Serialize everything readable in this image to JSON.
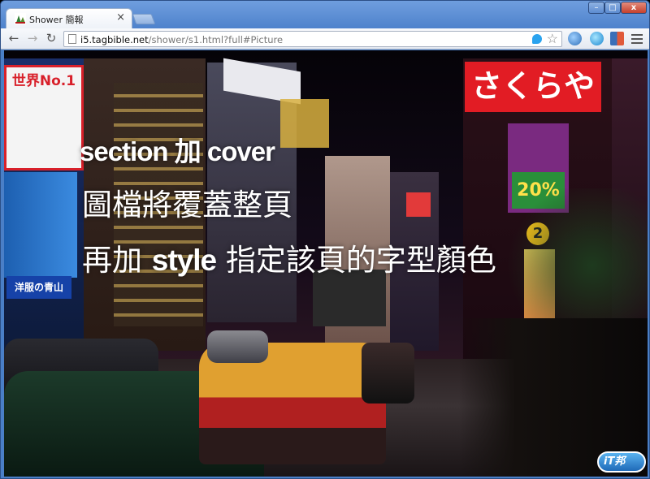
{
  "browser": {
    "tab_title": "Shower 簡報",
    "tab_close": "×",
    "url_domain": "i5.tagbible.net",
    "url_path": "/shower/s1.html?full#Picture",
    "window_controls": {
      "minimize": "–",
      "maximize": "□",
      "close": "x"
    },
    "nav": {
      "back": "←",
      "forward": "→",
      "reload": "↻"
    },
    "star": "☆",
    "icons": [
      "page-icon",
      "twitter-bird-icon",
      "star-icon",
      "globe-extension-icon",
      "pen-extension-icon",
      "grid-extension-icon",
      "menu-icon"
    ]
  },
  "slide": {
    "heading_section": "section 加 cover",
    "line2": "圖檔將覆蓋整頁",
    "line3_prefix": "再加 ",
    "line3_style": "style",
    "line3_suffix": " 指定該頁的字型顏色"
  },
  "photo_signs": {
    "top_left": "世界No.1",
    "top_right": "さくらや",
    "percent": "20%",
    "left_blue": "洋服の青山",
    "number_sign": "2"
  },
  "watermark": {
    "text": "iT邦"
  },
  "colors": {
    "titlebar": "#4e82cc",
    "tab_bg": "#ffffff",
    "text_overlay": "#ffffff"
  }
}
